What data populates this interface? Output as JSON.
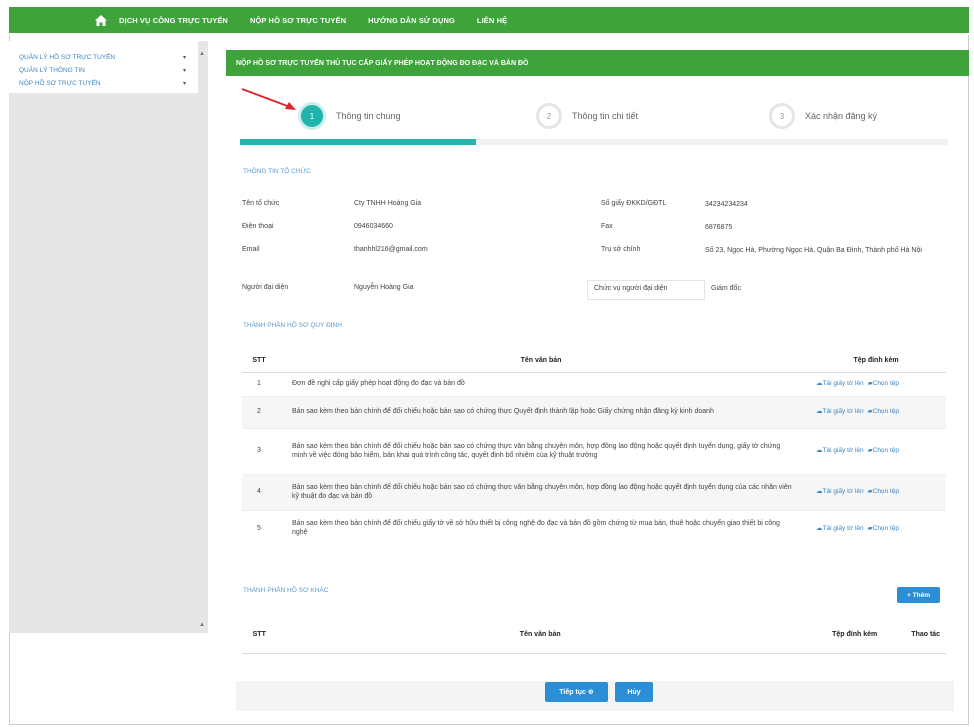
{
  "nav": {
    "items": [
      "DỊCH VỤ CÔNG TRỰC TUYẾN",
      "NỘP HỒ SƠ TRỰC TUYẾN",
      "HƯỚNG DẪN SỬ DỤNG",
      "LIÊN HỆ"
    ],
    "color": "#3ea33a"
  },
  "sidebar": {
    "items": [
      {
        "label": "QUẢN LÝ HỒ SƠ TRỰC TUYẾN"
      },
      {
        "label": "QUẢN LÝ THÔNG TIN"
      },
      {
        "label": "NỘP HỒ SƠ TRỰC TUYẾN"
      }
    ],
    "chevron": "▾",
    "scroll_up": "▲",
    "scroll_down": "▲"
  },
  "main": {
    "header": "NỘP HỒ SƠ TRỰC TUYẾN THỦ TỤC CẤP GIẤY PHÉP HOẠT ĐỘNG ĐO ĐẠC VÀ BẢN ĐỒ"
  },
  "stepper": {
    "steps": [
      {
        "number": "1",
        "label": "Thông tin chung"
      },
      {
        "number": "2",
        "label": "Thông tin chi tiết"
      },
      {
        "number": "3",
        "label": "Xác nhận đăng ký"
      }
    ],
    "progress_fraction": 0.333,
    "accent": "#1fb5ad"
  },
  "org": {
    "section_title": "THÔNG TIN TỔ CHỨC",
    "rows": [
      {
        "l1": "Tên tổ chức",
        "v1": "Cty TNHH Hoàng Gia",
        "l2": "Số giấy ĐKKD/GĐTL",
        "v2": "34234234234"
      },
      {
        "l1": "Điện thoại",
        "v1": "0946034660",
        "l2": "Fax",
        "v2": "6876875"
      },
      {
        "l1": "Email",
        "v1": "thanhhl216@gmail.com",
        "l2": "Trụ sở chính",
        "v2": "Số 23, Ngọc Hà, Phường Ngọc Hà, Quận Ba Đình, Thành phố Hà Nội"
      },
      {
        "l1": "Người đại diện",
        "v1": "Nguyễn Hoàng Gia",
        "l2": "Chức vụ người đại diện",
        "v2": "Giám đốc"
      }
    ]
  },
  "required_docs": {
    "section_title": "THÀNH PHẦN HỒ SƠ QUY ĐỊNH",
    "headers": {
      "stt": "STT",
      "name": "Tên văn bản",
      "attachment": "Tệp đính kèm"
    },
    "download_label": "Tải giấy tờ lên",
    "choose_label": "Chọn tệp",
    "rows": [
      {
        "stt": "1",
        "name": "Đơn đề nghị cấp giấy phép hoạt động đo đạc và bản đồ"
      },
      {
        "stt": "2",
        "name": "Bản sao kèm theo bản chính để đối chiếu hoặc bản sao có chứng thực Quyết định thành lập hoặc Giấy chứng nhận đăng ký kinh doanh"
      },
      {
        "stt": "3",
        "name": "Bản sao kèm theo bản chính để đối chiếu hoặc bản sao có chứng thực văn bằng chuyên môn, hợp đồng lao động hoặc quyết định tuyển dụng, giấy tờ chứng minh về việc đóng bảo hiểm, bản khai quá trình công tác, quyết định bổ nhiệm của kỹ thuật trưởng"
      },
      {
        "stt": "4",
        "name": "Bản sao kèm theo bản chính để đối chiếu hoặc bản sao có chứng thực văn bằng chuyên môn, hợp đồng lao động hoặc quyết định tuyển dụng của các nhân viên kỹ thuật đo đạc và bản đồ"
      },
      {
        "stt": "5",
        "name": "Bản sao kèm theo bản chính để đối chiếu giấy tờ về sở hữu thiết bị công nghệ đo đạc và bản đồ gồm chứng từ mua bán, thuê hoặc chuyển giao thiết bị công nghệ"
      }
    ]
  },
  "other_docs": {
    "section_title": "THÀNH PHẦN HỒ SƠ KHÁC",
    "add_label": "+ Thêm",
    "headers": {
      "stt": "STT",
      "name": "Tên văn bản",
      "attachment": "Tệp đính kèm",
      "action": "Thao tác"
    }
  },
  "footer": {
    "continue_label": "Tiếp tục ⊕",
    "cancel_label": "Hủy"
  }
}
